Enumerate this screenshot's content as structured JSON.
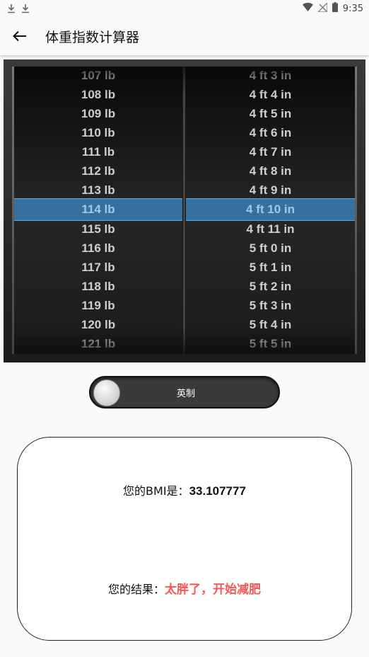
{
  "status_bar": {
    "time": "9:35",
    "left_icons": [
      "download-icon",
      "download-icon"
    ],
    "right_icons": [
      "wifi-icon",
      "no-signal-icon",
      "battery-icon"
    ]
  },
  "app_bar": {
    "back_icon": "arrow-left-icon",
    "title": "体重指数计算器"
  },
  "picker": {
    "weight_rows": [
      "107 lb",
      "108 lb",
      "109 lb",
      "110 lb",
      "111 lb",
      "112 lb",
      "113 lb",
      "114 lb",
      "115 lb",
      "116 lb",
      "117 lb",
      "118 lb",
      "119 lb",
      "120 lb",
      "121 lb"
    ],
    "height_rows": [
      "4 ft 3 in",
      "4 ft 4 in",
      "4 ft 5 in",
      "4 ft 6 in",
      "4 ft 7 in",
      "4 ft 8 in",
      "4 ft 9 in",
      "4 ft 10 in",
      "4 ft 11 in",
      "5 ft 0 in",
      "5 ft 1 in",
      "5 ft 2 in",
      "5 ft 3 in",
      "5 ft 4 in",
      "5 ft 5 in"
    ],
    "selected_weight": "114 lb",
    "selected_height": "4 ft 10 in",
    "highlight_color": "#3e89c4"
  },
  "unit_toggle": {
    "label": "英制",
    "checked": false
  },
  "result": {
    "bmi_prefix": "您的BMI是：",
    "bmi_value": "33.107777",
    "result_prefix": "您的结果：",
    "result_value": "太胖了，开始减肥",
    "result_color": "#f45656"
  }
}
